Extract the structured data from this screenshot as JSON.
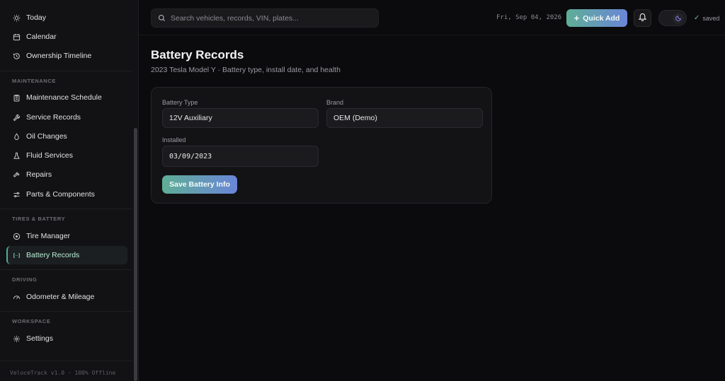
{
  "sidebar": {
    "top_items": [
      {
        "label": "Today",
        "icon": "sun-icon"
      },
      {
        "label": "Calendar",
        "icon": "calendar-icon"
      },
      {
        "label": "Ownership Timeline",
        "icon": "history-icon"
      }
    ],
    "sections": {
      "maintenance": "MAINTENANCE",
      "tires_battery": "TIRES & BATTERY",
      "driving": "DRIVING",
      "workspace": "WORKSPACE"
    },
    "maintenance_items": [
      {
        "label": "Maintenance Schedule",
        "icon": "clipboard-icon"
      },
      {
        "label": "Service Records",
        "icon": "wrench-icon"
      },
      {
        "label": "Oil Changes",
        "icon": "droplet-icon"
      },
      {
        "label": "Fluid Services",
        "icon": "flask-icon"
      },
      {
        "label": "Repairs",
        "icon": "hammer-icon"
      },
      {
        "label": "Parts & Components",
        "icon": "sliders-icon"
      }
    ],
    "tires_items": [
      {
        "label": "Tire Manager",
        "icon": "tire-icon"
      },
      {
        "label": "Battery Records",
        "icon": "battery-icon",
        "active": true
      }
    ],
    "driving_items": [
      {
        "label": "Odometer & Mileage",
        "icon": "gauge-icon"
      }
    ],
    "workspace_items": [
      {
        "label": "Settings",
        "icon": "gear-icon"
      }
    ],
    "footer": "VeloceTrack v1.0 · 100% Offline"
  },
  "topbar": {
    "search_placeholder": "Search vehicles, records, VIN, plates...",
    "date": "Fri, Sep 04, 2026",
    "quick_add_label": "Quick Add",
    "saved_label": "saved"
  },
  "page": {
    "title": "Battery Records",
    "subtitle": "2023 Tesla Model Y · Battery type, install date, and health"
  },
  "form": {
    "battery_type_label": "Battery Type",
    "battery_type_value": "12V Auxiliary",
    "brand_label": "Brand",
    "brand_value": "OEM (Demo)",
    "installed_label": "Installed",
    "installed_value": "03/09/2023",
    "save_label": "Save Battery Info"
  },
  "colors": {
    "accent_start": "#5fae96",
    "accent_end": "#6a86d8",
    "active_border": "#4fae8e",
    "saved_check": "#5fc29a"
  }
}
